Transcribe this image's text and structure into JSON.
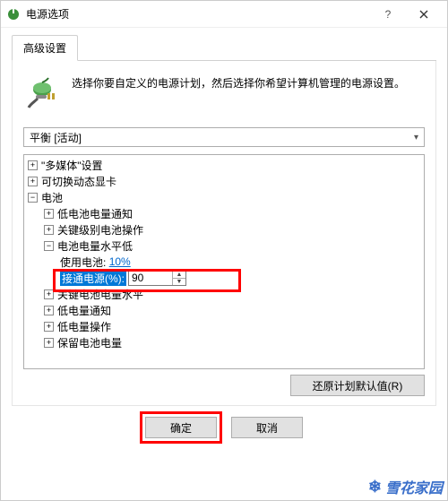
{
  "window": {
    "title": "电源选项",
    "help_title": "帮助",
    "close_title": "关闭"
  },
  "tabs": {
    "active": "高级设置"
  },
  "description": "选择你要自定义的电源计划，然后选择你希望计算机管理的电源设置。",
  "plan_combo": {
    "selected": "平衡 [活动]"
  },
  "tree": {
    "multimedia": {
      "label": "\"多媒体\"设置",
      "exp": "+"
    },
    "switchable_gpu": {
      "label": "可切换动态显卡",
      "exp": "+"
    },
    "battery": {
      "label": "电池",
      "exp": "−",
      "children": {
        "low_notify": {
          "label": "低电池电量通知",
          "exp": "+"
        },
        "critical_act": {
          "label": "关键级别电池操作",
          "exp": "+"
        },
        "low_level": {
          "label": "电池电量水平低",
          "exp": "−",
          "on_battery_label": "使用电池:",
          "on_battery_value": "10%",
          "plugged_label": "接通电源(%):",
          "plugged_value": "90"
        },
        "critical_level": {
          "label": "关键电池电量水平",
          "exp": "+"
        },
        "low_notify2": {
          "label": "低电量通知",
          "exp": "+"
        },
        "low_act": {
          "label": "低电量操作",
          "exp": "+"
        },
        "reserve_level": {
          "label": "保留电池电量",
          "exp": "+"
        }
      }
    }
  },
  "buttons": {
    "restore_defaults": "还原计划默认值(R)",
    "ok": "确定",
    "cancel": "取消"
  },
  "watermark": "雪花家园",
  "colors": {
    "selection": "#0078d7",
    "link": "#0066cc",
    "highlight": "#f00"
  }
}
